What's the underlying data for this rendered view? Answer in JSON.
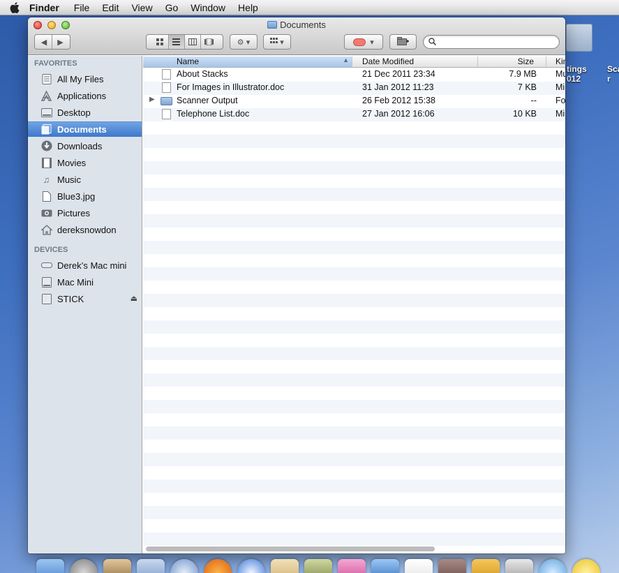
{
  "menubar": {
    "app_name": "Finder",
    "items": [
      "File",
      "Edit",
      "View",
      "Go",
      "Window",
      "Help"
    ]
  },
  "desktop": {
    "labels": [
      "tings",
      "Sca"
    ],
    "labels_line2": [
      "012",
      "r"
    ]
  },
  "window": {
    "title": "Documents"
  },
  "toolbar": {
    "search": {
      "value": "",
      "placeholder": ""
    }
  },
  "sidebar": {
    "favorites_header": "FAVORITES",
    "favorites": [
      {
        "label": "All My Files",
        "icon": "all-files-icon"
      },
      {
        "label": "Applications",
        "icon": "applications-icon"
      },
      {
        "label": "Desktop",
        "icon": "desktop-icon"
      },
      {
        "label": "Documents",
        "icon": "documents-icon",
        "selected": true
      },
      {
        "label": "Downloads",
        "icon": "downloads-icon"
      },
      {
        "label": "Movies",
        "icon": "movies-icon"
      },
      {
        "label": "Music",
        "icon": "music-icon"
      },
      {
        "label": "Blue3.jpg",
        "icon": "file-icon"
      },
      {
        "label": "Pictures",
        "icon": "pictures-icon"
      },
      {
        "label": "dereksnowdon",
        "icon": "home-icon"
      }
    ],
    "devices_header": "DEVICES",
    "devices": [
      {
        "label": "Derek’s Mac mini",
        "icon": "computer-icon"
      },
      {
        "label": "Mac Mini",
        "icon": "hard-drive-icon"
      },
      {
        "label": "STICK",
        "icon": "usb-drive-icon",
        "ejectable": true
      }
    ]
  },
  "list": {
    "columns": {
      "name": "Name",
      "date_modified": "Date Modified",
      "size": "Size",
      "kind": "Kin"
    },
    "rows": [
      {
        "name": "About Stacks",
        "date": "21 Dec 2011 23:34",
        "size": "7.9 MB",
        "kind": "Mu",
        "type": "document"
      },
      {
        "name": "For Images in Illustrator.doc",
        "date": "31 Jan 2012 11:23",
        "size": "7 KB",
        "kind": "Mi",
        "type": "document"
      },
      {
        "name": "Scanner Output",
        "date": "26 Feb 2012 15:38",
        "size": "--",
        "kind": "Fo",
        "type": "folder"
      },
      {
        "name": "Telephone List.doc",
        "date": "27 Jan 2012 16:06",
        "size": "10 KB",
        "kind": "Mi",
        "type": "document"
      }
    ]
  },
  "colors": {
    "selection": "#3e78cb",
    "sidebar_bg": "#dde3ea",
    "desktop": "#3f6fc0"
  }
}
